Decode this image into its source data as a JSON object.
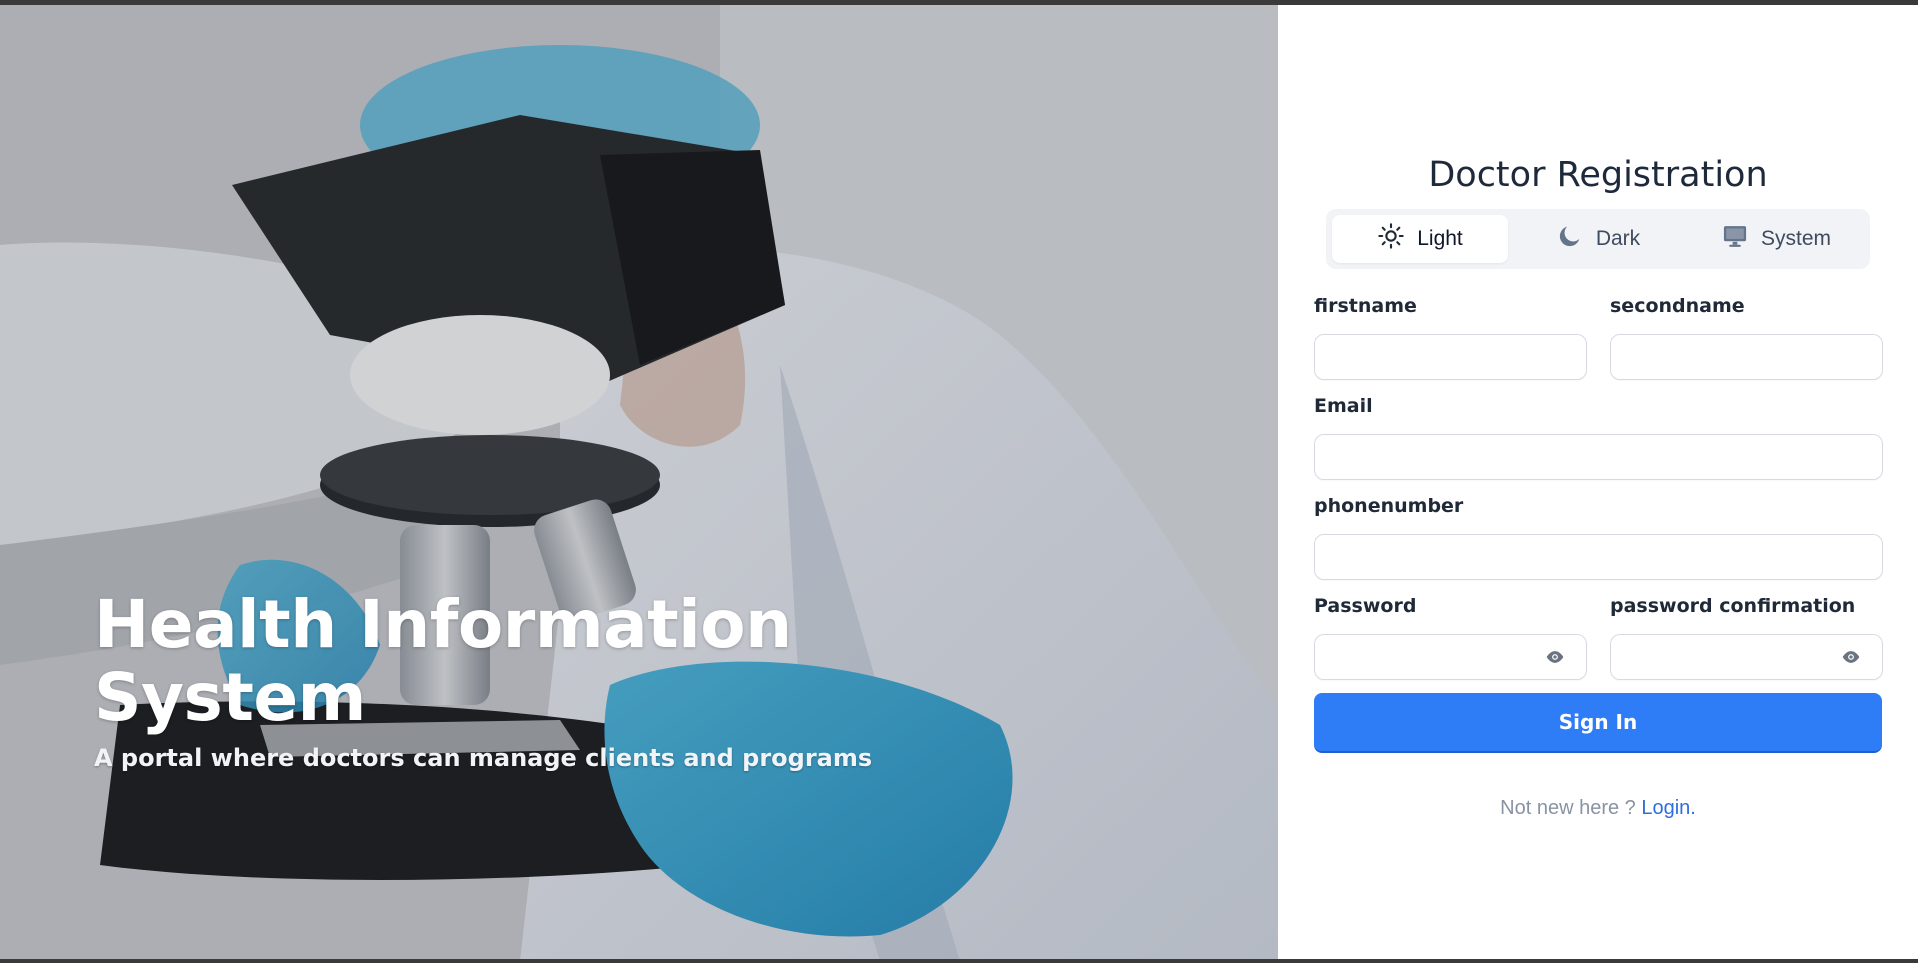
{
  "hero": {
    "title": "Health Information System",
    "subtitle": "A portal where doctors can manage clients and programs"
  },
  "form": {
    "title": "Doctor Registration",
    "theme_options": [
      {
        "label": "Light",
        "icon": "sun-icon",
        "active": true
      },
      {
        "label": "Dark",
        "icon": "moon-icon",
        "active": false
      },
      {
        "label": "System",
        "icon": "monitor-icon",
        "active": false
      }
    ],
    "fields": {
      "firstname": {
        "label": "firstname",
        "value": ""
      },
      "secondname": {
        "label": "secondname",
        "value": ""
      },
      "email": {
        "label": "Email",
        "value": ""
      },
      "phonenumber": {
        "label": "phonenumber",
        "value": ""
      },
      "password": {
        "label": "Password",
        "value": ""
      },
      "password_confirmation": {
        "label": "password confirmation",
        "value": ""
      }
    },
    "submit_label": "Sign In",
    "footer_text": "Not new here ?",
    "footer_link": "Login."
  },
  "colors": {
    "accent": "#2e7cf6",
    "link": "#2e6fe0",
    "title": "#1e293b"
  }
}
